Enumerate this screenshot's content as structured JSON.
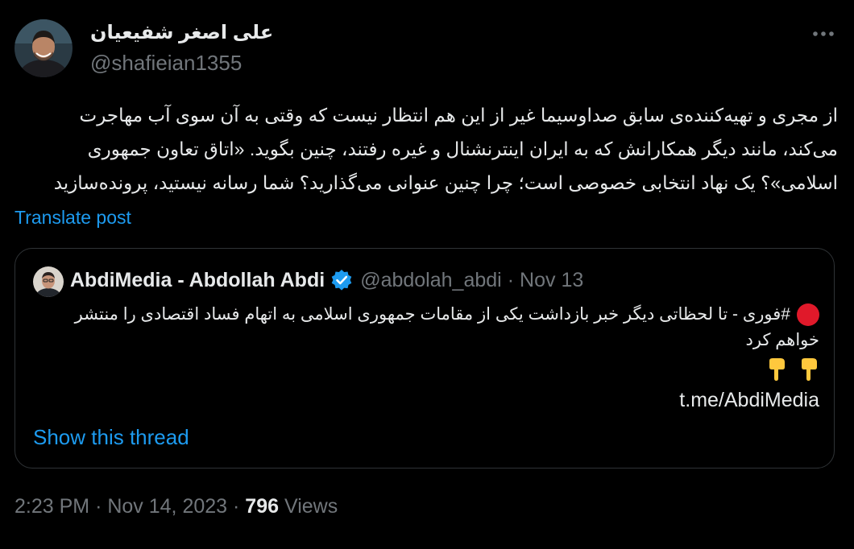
{
  "tweet": {
    "author": {
      "display_name": "علی اصغر شفیعیان",
      "handle": "@shafieian1355",
      "avatar_icon": "person-avatar"
    },
    "more_icon": "more-dots-icon",
    "text_line_1": "از مجری و تهیه‌کننده‌ی سابق صداوسیما غیر از این هم انتظار نیست که وقتی به آن سوی آب مهاجرت",
    "text_line_2": "می‌کند، مانند دیگر همکارانش که به ایران اینترنشنال و غیره رفتند، چنین بگوید. «اتاق تعاون جمهوری",
    "text_line_3": "اسلامی»؟ یک نهاد انتخابی خصوصی است؛ چرا چنین عنوانی می‌گذارید؟ شما رسانه نیستید، پرونده‌سازید",
    "translate_label": "Translate post",
    "quoted": {
      "display_name": "AbdiMedia - Abdollah Abdi",
      "verified_icon": "verified-badge-icon",
      "handle": "@abdolah_abdi",
      "separator": "·",
      "date": "Nov 13",
      "hashtag": "#فوری",
      "body_line_1": " - تا لحظاتی دیگر خبر بازداشت یکی از مقامات جمهوری اسلامی به اتهام فساد اقتصادی را منتشر",
      "body_line_2": "خواهم کرد",
      "emojis": "👇👇",
      "link": "t.me/AbdiMedia",
      "show_thread_label": "Show this thread"
    },
    "meta": {
      "time": "2:23 PM",
      "sep1": "·",
      "date": "Nov 14, 2023",
      "sep2": "·",
      "views_count": "796",
      "views_label": "Views"
    },
    "colors": {
      "background": "#000000",
      "text": "#e7e9ea",
      "secondary": "#71767b",
      "accent": "#1d9bf0",
      "border": "#2f3336"
    }
  }
}
